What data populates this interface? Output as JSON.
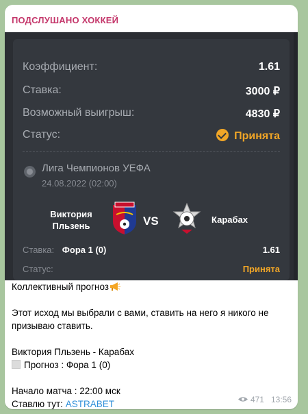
{
  "channel": {
    "name": "ПОДСЛУШАНО ХОККЕЙ"
  },
  "card": {
    "rows": [
      {
        "label": "Коэффициент:",
        "value": "1.61"
      },
      {
        "label": "Ставка:",
        "value": "3000 ₽"
      },
      {
        "label": "Возможный выигрыш:",
        "value": "4830 ₽"
      },
      {
        "label": "Статус:",
        "value": "Принята"
      }
    ],
    "league": "Лига Чемпионов УЕФА",
    "date": "24.08.2022 (02:00)",
    "team1": "Виктория Пльзень",
    "vs": "VS",
    "team2": "Карабах",
    "bet_label": "Ставка:",
    "bet_value": "Фора 1 (0)",
    "bet_odd": "1.61",
    "status_label": "Статус:",
    "status_value": "Принята",
    "accent": "#f1a627"
  },
  "message": {
    "line1": "Коллективный прогноз",
    "line2": "Этот исход мы выбрали с вами, ставить на него я никого не",
    "line3": "призываю ставить.",
    "line4": "Виктория Пльзень - Карабах",
    "line5": "Прогноз : Фора 1 (0)",
    "line6": "Начало матча : 22:00 мск",
    "line7_prefix": "Ставлю тут: ",
    "line7_link": "ASTRABET",
    "views": "471",
    "time": "13:56"
  },
  "icons": [
    "check-circle-icon",
    "league-ball-icon",
    "megaphone-icon",
    "checkbox-icon",
    "eye-icon"
  ]
}
